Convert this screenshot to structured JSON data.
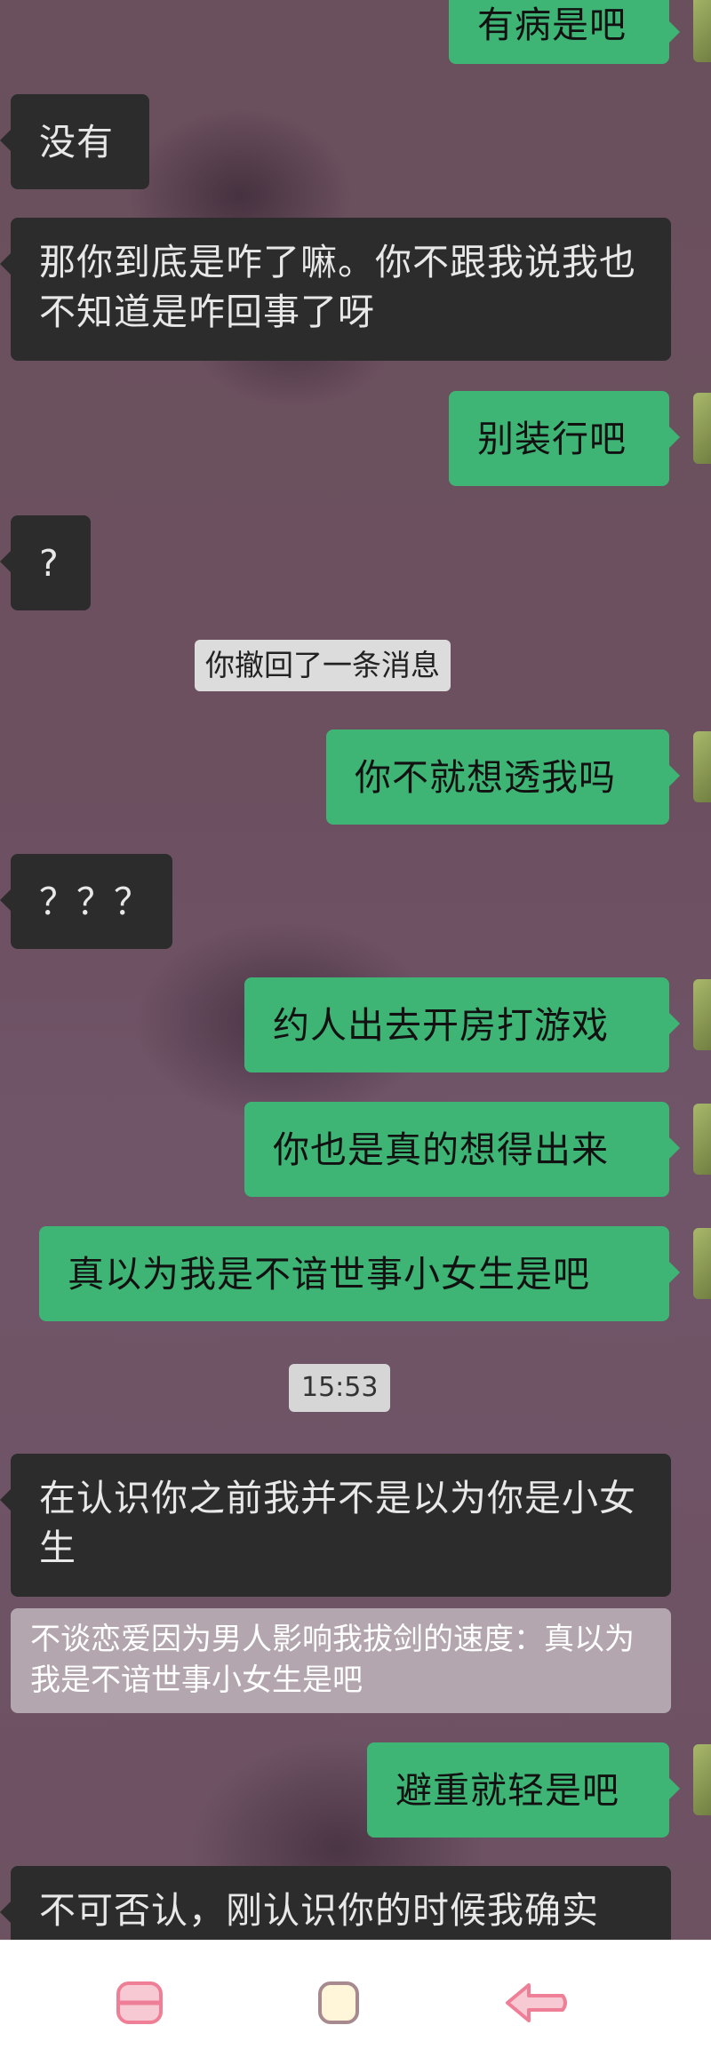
{
  "messages": [
    {
      "text": "有病是吧"
    },
    {
      "text": "没有"
    },
    {
      "text": "那你到底是咋了嘛。你不跟我说我也不知道是咋回事了呀"
    },
    {
      "text": "别装行吧"
    },
    {
      "text": "?"
    },
    {
      "text": "你撤回了一条消息"
    },
    {
      "text": "你不就想透我吗"
    },
    {
      "text": "？？？"
    },
    {
      "text": "约人出去开房打游戏"
    },
    {
      "text": "你也是真的想得出来"
    },
    {
      "text": "真以为我是不谙世事小女生是吧"
    },
    {
      "text": "15:53"
    },
    {
      "text": "在认识你之前我并不是以为你是小女生"
    },
    {
      "text": "不谈恋爱因为男人影响我拔剑的速度：真以为我是不谙世事小女生是吧"
    },
    {
      "text": "避重就轻是吧"
    },
    {
      "text": "不可否认，刚认识你的时候我确实"
    }
  ],
  "colors": {
    "sent_bubble": "#3eb575",
    "received_bubble": "#2c2c2c",
    "background": "#6c5060"
  },
  "navbar": {
    "icons": [
      "menu-icon",
      "home-icon",
      "back-icon"
    ]
  }
}
